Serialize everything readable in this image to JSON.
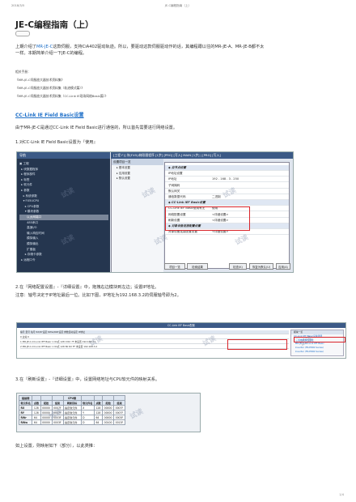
{
  "page_header": {
    "date": "2018/3/5",
    "center_title": "JE-C编程指南（上）"
  },
  "title": "JE-C编程指南（上）",
  "intro": {
    "line1_pre": "上期介绍了",
    "line1_link": "MR-JE-C",
    "line1_post": "这款伺服，支持CiA402驱动轨迹。所以，要驱动这款伺服驱动作的话，其编程跟以往的MR-JE-A、MR-JE-B都不太",
    "line2": "一样。本期简单介绍一下JE-C的编程。"
  },
  "refs": {
    "label": "相关手册：",
    "items": [
      "《MR-JE-C伺服放大器技术资料集》",
      "《MR-JE-C伺服放大器技术资料集（轨迹模式篇）》",
      "《MR-JE-C伺服放大器技术资料集（CC-Link IE现场网络Basic篇）》"
    ]
  },
  "section": "CC-Link IE Field Basic设置",
  "para1": "由于MR-JE-C是通过CC-Link IE Field Basic进行通信的，所以首先需要进行网络设置。",
  "step1": "1.对CC-Link IE Field Basic设置为『使用』",
  "shot1": {
    "nav_title": "导航",
    "nav_items": [
      "▣ 工程",
      "  ▸ 块数据程序",
      "  ▸ 程序部件",
      "  ▸ 标签",
      "  ▸ 软元件",
      "  ▸ 参数",
      "    ▸ 系统参数",
      "    ▾ FX5UCPU",
      "      ▸ CPU参数",
      "      ▾ 模块参数",
      "        以太网端口",
      "        485串口",
      "        高速I/O",
      "        输入响应时间",
      "        模拟输入",
      "        模拟输出",
      "        扩展板",
      "      ▸ 存储卡参数",
      "  ▸ 远程口令"
    ],
    "selected_index": 10,
    "tab_label": "[工程 F)] 块(FX5)/梯形图程序 [1步] [PRG] [写入] MAIN [1步]  |  [PRG] [写入]",
    "mid_title": "设置项目一览",
    "mid_items": [
      "▸ 基本设置",
      "▸ 应用设置",
      "▸ 默认设置"
    ],
    "panel_title": "设置项目",
    "panel_rows": [
      {
        "k": "◆ 自节点设置",
        "v": "",
        "grp": true
      },
      {
        "k": "IP地址设置",
        "v": ""
      },
      {
        "k": "IP地址",
        "v": "192 . 168 . 3 . 250"
      },
      {
        "k": "子网掩码",
        "v": ""
      },
      {
        "k": "默认网关",
        "v": ""
      },
      {
        "k": "通信数据代码",
        "v": "二进制"
      },
      {
        "k": "◆ CC-Link IEF Basic设置",
        "v": "",
        "grp": true
      },
      {
        "k": "CC-Link IEF Basic使用有无",
        "v": "使用"
      },
      {
        "k": "网络配置设置",
        "v": "<详细设置>"
      },
      {
        "k": "刷新设置",
        "v": "<详细设置>"
      },
      {
        "k": "◆ 对象设备连接配置设置",
        "v": "",
        "grp": true
      },
      {
        "k": "对象设备连接配置设置",
        "v": "<详细设置>"
      }
    ],
    "buttons": [
      "项目一览",
      "检索结果",
      "检查(K)",
      "恢复为默认(U)",
      "应用(A)"
    ]
  },
  "step2": "2.在『网络配置设置』-『详细设置』中，拖拽右边模块到左边；设置IP地址。",
  "step2_note": "注意：轴号决定于IP地址最后一位。比如下图，IP地址为192.168.3.2的伺服轴号即为2。",
  "shot2": {
    "title": "CC-Link IEF Basic配置",
    "header_row": "编号   型号                 站号   RX/RY设定   RWw/RWr设定   参数自动设定   IP地址",
    "rows": [
      "0   主站                      0",
      "1   MR-JE-C-CC-Link IEF Basic   1   64点   128     0  RX  7F   未设置   192.168.3.1",
      "2   MR-JE-C-CC-Link IEF Basic   1   64点   128   80  RX  FF   未设置   192.168.3.2"
    ],
    "side_items": [
      "模块一览",
      "CC-Link IEF Basic设备选择",
      "▾ 三菱电机株式会社",
      "  MR-JE-C-CC-Link IEF Basic",
      "  Inverter (FR-E800 Series)",
      "  Inverter (FR-E800 Series)"
    ]
  },
  "step3": "3.在『刷新设置』-『详细设置』中，设置网络地址与CPU软元件的映射关系。",
  "shot3": {
    "head1": [
      "链接侧",
      "",
      "",
      "",
      "CPU侧",
      "",
      "",
      "",
      ""
    ],
    "head2": [
      "软元件名",
      "点数",
      "起始",
      "结束",
      "刷新目标",
      "软元件名",
      "点数",
      "起始",
      "结束"
    ],
    "rows": [
      [
        "RX",
        "128",
        "00000",
        "0007F",
        "指定软元件",
        "X",
        "128",
        "00000",
        "0007F"
      ],
      [
        "RY",
        "128",
        "00000",
        "0007F",
        "指定软元件",
        "Y",
        "128",
        "00000",
        "0007F"
      ],
      [
        "RWr",
        "64",
        "00000",
        "0003F",
        "指定软元件",
        "D",
        "64",
        "00000",
        "0003F"
      ],
      [
        "RWw",
        "64",
        "00000",
        "0003F",
        "指定软元件",
        "D",
        "64",
        "00100",
        "0013F"
      ]
    ]
  },
  "para_end": "如上设置，则映射如下（部分），以此类推：",
  "watermark": "试读",
  "page_number": "1/4"
}
